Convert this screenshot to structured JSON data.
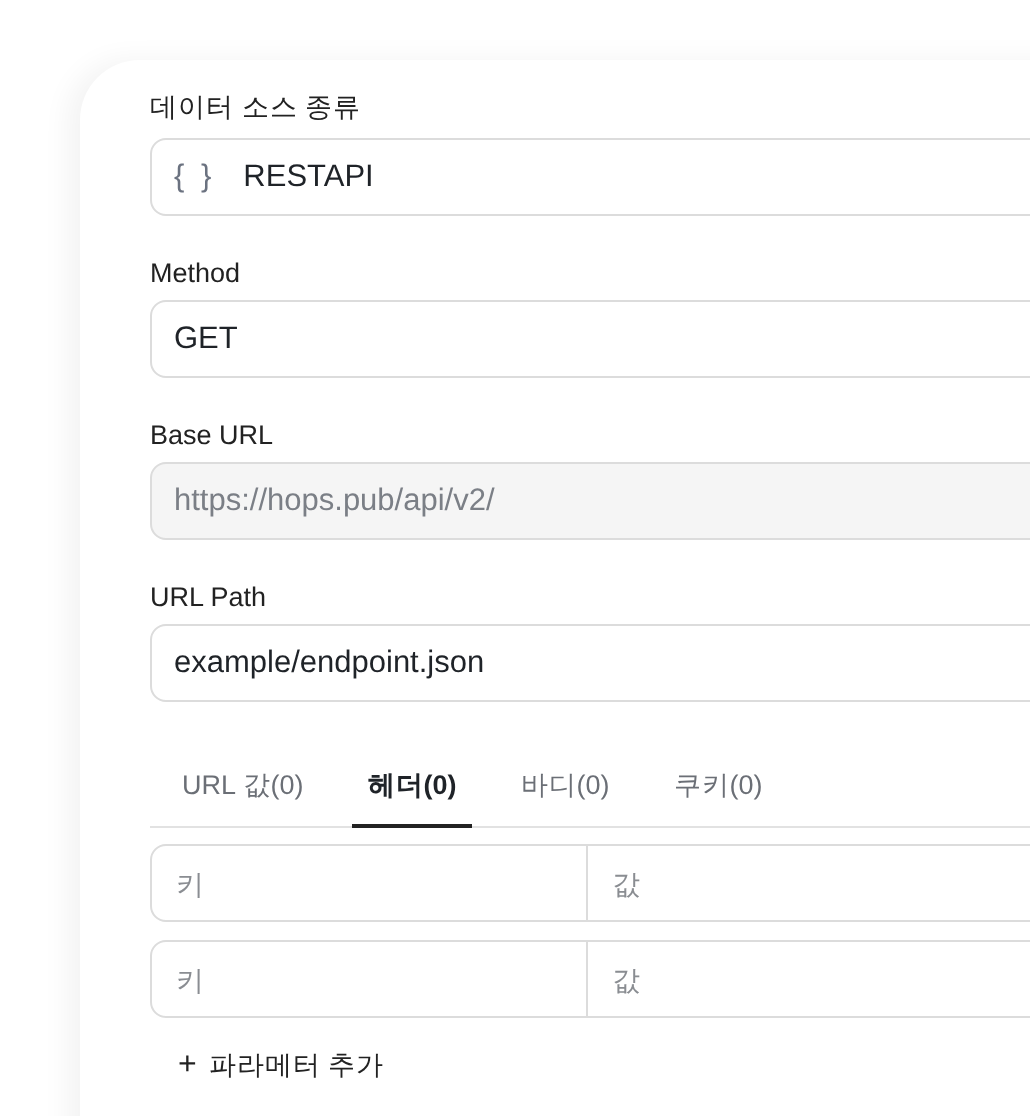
{
  "fields": [
    {
      "kind": "select",
      "label": "데이터 소스 종류",
      "icon": "{ }",
      "value": "RESTAPI",
      "disabled": false
    },
    {
      "kind": "select",
      "label": "Method",
      "value": "GET",
      "disabled": false
    },
    {
      "kind": "input",
      "label": "Base URL",
      "value": "https://hops.pub/api/v2/",
      "disabled": true
    },
    {
      "kind": "input",
      "label": "URL Path",
      "value": "example/endpoint.json",
      "disabled": false
    }
  ],
  "tabs": [
    {
      "label": "URL 값(0)",
      "selected": false
    },
    {
      "label": "헤더(0)",
      "selected": true
    },
    {
      "label": "바디(0)",
      "selected": false
    },
    {
      "label": "쿠키(0)",
      "selected": false
    }
  ],
  "params": [
    {
      "key_placeholder": "키",
      "value_placeholder": "값"
    },
    {
      "key_placeholder": "키",
      "value_placeholder": "값"
    }
  ],
  "add_button": {
    "icon": "+",
    "label": "파라메터 추가"
  }
}
